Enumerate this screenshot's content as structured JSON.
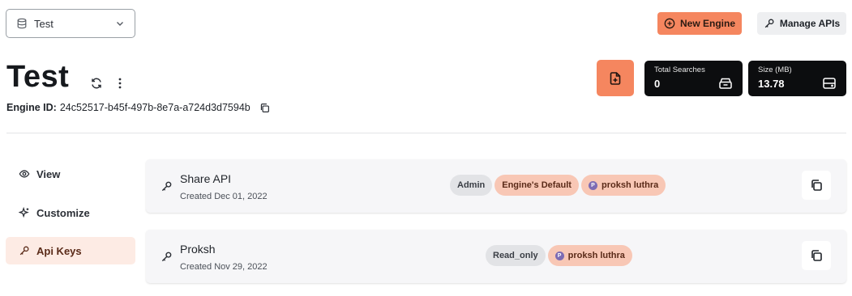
{
  "engine_selector": {
    "value": "Test",
    "icon": "database-icon"
  },
  "header_buttons": {
    "new_engine": "New Engine",
    "manage_apis": "Manage APIs"
  },
  "engine": {
    "title": "Test",
    "id_label": "Engine ID:",
    "id_value": "24c52517-b45f-497b-8e7a-a724d3d7594b"
  },
  "stats": {
    "total_searches": {
      "label": "Total Searches",
      "value": "0"
    },
    "size": {
      "label": "Size (MB)",
      "value": "13.78"
    }
  },
  "sidebar": {
    "items": [
      {
        "label": "View",
        "icon": "eye-icon"
      },
      {
        "label": "Customize",
        "icon": "sparkle-icon"
      },
      {
        "label": "Api Keys",
        "icon": "key-icon",
        "active": true
      }
    ]
  },
  "api_keys": [
    {
      "name": "Share API",
      "created": "Created Dec 01, 2022",
      "badges": [
        "Admin",
        "Engine's Default",
        "proksh luthra"
      ]
    },
    {
      "name": "Proksh",
      "created": "Created Nov 29, 2022",
      "badges": [
        "Read_only",
        "proksh luthra"
      ]
    }
  ],
  "colors": {
    "accent": "#f5865f",
    "accent_soft": "#f8c7b5",
    "active_nav_bg": "#fdebe4",
    "stat_bg": "#0c0d0f"
  }
}
